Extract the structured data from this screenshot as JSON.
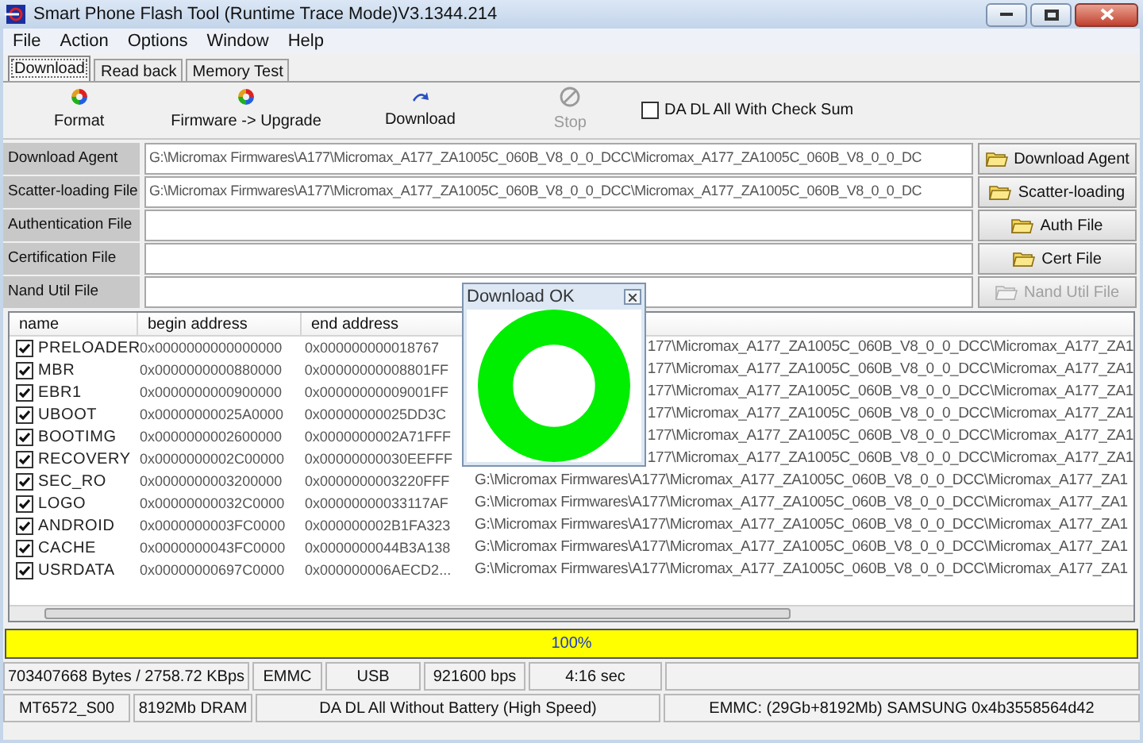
{
  "window": {
    "title": "Smart Phone Flash Tool (Runtime Trace Mode)V3.1344.214"
  },
  "menu": [
    "File",
    "Action",
    "Options",
    "Window",
    "Help"
  ],
  "tabs": [
    {
      "label": "Download",
      "selected": true
    },
    {
      "label": "Read back",
      "selected": false
    },
    {
      "label": "Memory Test",
      "selected": false
    }
  ],
  "toolbar": [
    {
      "label": "Format",
      "kind": "format",
      "disabled": false
    },
    {
      "label": "Firmware -> Upgrade",
      "kind": "upgrade",
      "disabled": false
    },
    {
      "label": "Download",
      "kind": "download",
      "disabled": false
    },
    {
      "label": "Stop",
      "kind": "stop",
      "disabled": true
    }
  ],
  "checksum_option": {
    "label": "DA DL All With Check Sum",
    "checked": false
  },
  "file_rows": [
    {
      "label": "Download Agent",
      "value": "G:\\Micromax Firmwares\\A177\\Micromax_A177_ZA1005C_060B_V8_0_0_DCC\\Micromax_A177_ZA1005C_060B_V8_0_0_DC",
      "button": "Download Agent",
      "disabled": false
    },
    {
      "label": "Scatter-loading File",
      "value": "G:\\Micromax Firmwares\\A177\\Micromax_A177_ZA1005C_060B_V8_0_0_DCC\\Micromax_A177_ZA1005C_060B_V8_0_0_DC",
      "button": "Scatter-loading",
      "disabled": false
    },
    {
      "label": "Authentication File",
      "button": "Auth File",
      "disabled": false
    },
    {
      "label": "Certification File",
      "button": "Cert File",
      "disabled": false
    },
    {
      "label": "Nand Util File",
      "button": "Nand Util File",
      "disabled": true
    }
  ],
  "table": {
    "columns": [
      "name",
      "begin address",
      "end address"
    ],
    "rows": [
      {
        "name": "PRELOADER",
        "checked": true,
        "begin": "0x0000000000000000",
        "end": "0x000000000018767",
        "location": "177\\Micromax_A177_ZA1005C_060B_V8_0_0_DCC\\Micromax_A177_ZA1",
        "kind": "covered"
      },
      {
        "name": "MBR",
        "checked": true,
        "begin": "0x0000000000880000",
        "end": "0x00000000008801FF",
        "location": "177\\Micromax_A177_ZA1005C_060B_V8_0_0_DCC\\Micromax_A177_ZA1",
        "kind": "covered"
      },
      {
        "name": "EBR1",
        "checked": true,
        "begin": "0x0000000000900000",
        "end": "0x00000000009001FF",
        "location": "177\\Micromax_A177_ZA1005C_060B_V8_0_0_DCC\\Micromax_A177_ZA1",
        "kind": "covered"
      },
      {
        "name": "UBOOT",
        "checked": true,
        "begin": "0x00000000025A0000",
        "end": "0x00000000025DD3C",
        "location": "177\\Micromax_A177_ZA1005C_060B_V8_0_0_DCC\\Micromax_A177_ZA1",
        "kind": "covered"
      },
      {
        "name": "BOOTIMG",
        "checked": true,
        "begin": "0x0000000002600000",
        "end": "0x0000000002A71FFF",
        "location": "177\\Micromax_A177_ZA1005C_060B_V8_0_0_DCC\\Micromax_A177_ZA1",
        "kind": "covered"
      },
      {
        "name": "RECOVERY",
        "checked": true,
        "begin": "0x0000000002C00000",
        "end": "0x00000000030EEFFF",
        "location": "177\\Micromax_A177_ZA1005C_060B_V8_0_0_DCC\\Micromax_A177_ZA1",
        "kind": "covered"
      },
      {
        "name": "SEC_RO",
        "checked": true,
        "begin": "0x0000000003200000",
        "end": "0x0000000003220FFF",
        "location": "G:\\Micromax Firmwares\\A177\\Micromax_A177_ZA1005C_060B_V8_0_0_DCC\\Micromax_A177_ZA1",
        "kind": "full"
      },
      {
        "name": "LOGO",
        "checked": true,
        "begin": "0x00000000032C0000",
        "end": "0x00000000033117AF",
        "location": "G:\\Micromax Firmwares\\A177\\Micromax_A177_ZA1005C_060B_V8_0_0_DCC\\Micromax_A177_ZA1",
        "kind": "full"
      },
      {
        "name": "ANDROID",
        "checked": true,
        "begin": "0x0000000003FC0000",
        "end": "0x000000002B1FA323",
        "location": "G:\\Micromax Firmwares\\A177\\Micromax_A177_ZA1005C_060B_V8_0_0_DCC\\Micromax_A177_ZA1",
        "kind": "full"
      },
      {
        "name": "CACHE",
        "checked": true,
        "begin": "0x0000000043FC0000",
        "end": "0x0000000044B3A138",
        "location": "G:\\Micromax Firmwares\\A177\\Micromax_A177_ZA1005C_060B_V8_0_0_DCC\\Micromax_A177_ZA1",
        "kind": "full"
      },
      {
        "name": "USRDATA",
        "checked": true,
        "begin": "0x00000000697C0000",
        "end": "0x000000006AECD2...",
        "location": "G:\\Micromax Firmwares\\A177\\Micromax_A177_ZA1005C_060B_V8_0_0_DCC\\Micromax_A177_ZA1",
        "kind": "full"
      }
    ]
  },
  "dialog": {
    "title": "Download OK"
  },
  "progress": {
    "label": "100%",
    "level": 1
  },
  "status_rows": [
    [
      "703407668 Bytes / 2758.72 KBps",
      "EMMC",
      "USB",
      "921600 bps",
      "4:16 sec"
    ],
    [
      "MT6572_S00",
      "8192Mb DRAM",
      "DA DL All Without Battery (High Speed)",
      "EMMC: (29Gb+8192Mb) SAMSUNG 0x4b3558564d42"
    ]
  ]
}
